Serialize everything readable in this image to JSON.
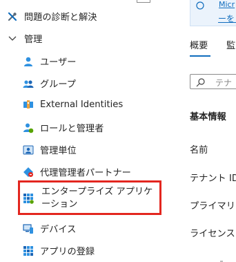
{
  "sidebar": {
    "items": [
      {
        "label": "問題の診断と解決"
      },
      {
        "label": "管理"
      },
      {
        "label": "ユーザー"
      },
      {
        "label": "グループ"
      },
      {
        "label": "External Identities"
      },
      {
        "label": "ロールと管理者"
      },
      {
        "label": "管理単位"
      },
      {
        "label": "代理管理者パートナー"
      },
      {
        "label": "エンタープライズ アプリケーション"
      },
      {
        "label": "デバイス"
      },
      {
        "label": "アプリの登録"
      }
    ]
  },
  "main": {
    "banner": {
      "link_line1": "Micr",
      "link_line2": "ーをま"
    },
    "tabs": [
      {
        "label": "概要"
      },
      {
        "label": "監"
      }
    ],
    "search": {
      "placeholder": "テナ"
    },
    "section_title": "基本情報",
    "fields": [
      {
        "label": "名前"
      },
      {
        "label": "テナント ID"
      },
      {
        "label": "プライマリ"
      },
      {
        "label": "ライセンス"
      }
    ]
  },
  "colors": {
    "highlight": "#e3261f",
    "accent": "#0f6cbd"
  }
}
